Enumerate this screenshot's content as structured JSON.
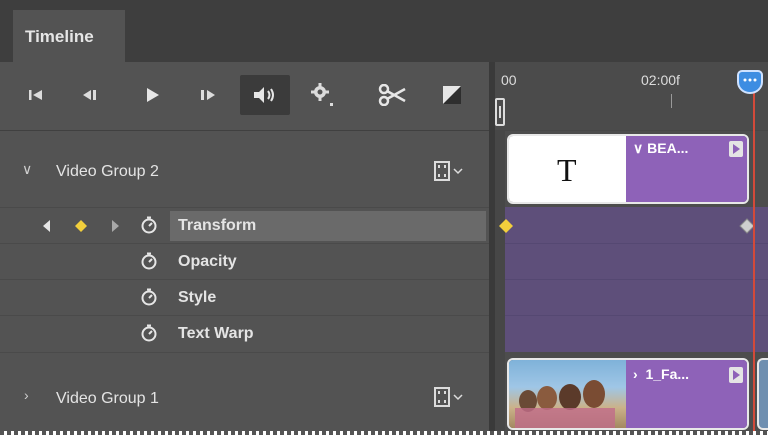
{
  "panel": {
    "tab_label": "Timeline"
  },
  "controls": [
    {
      "name": "go-to-first-frame-button",
      "icon": "skip-to-start-icon"
    },
    {
      "name": "previous-frame-button",
      "icon": "step-back-icon"
    },
    {
      "name": "play-button",
      "icon": "play-icon"
    },
    {
      "name": "next-frame-button",
      "icon": "step-forward-icon"
    },
    {
      "name": "mute-audio-button",
      "icon": "speaker-icon"
    },
    {
      "name": "settings-button",
      "icon": "gear-icon"
    },
    {
      "name": "split-at-playhead-button",
      "icon": "scissors-icon"
    },
    {
      "name": "transition-button",
      "icon": "transition-icon"
    }
  ],
  "ruler": {
    "start_label": "00",
    "mark_label": "02:00f"
  },
  "layers": {
    "group2": {
      "label": "Video Group 2",
      "expanded": true
    },
    "properties": [
      {
        "label": "Transform",
        "keyframed": true,
        "selected": true
      },
      {
        "label": "Opacity",
        "keyframed": false
      },
      {
        "label": "Style",
        "keyframed": false
      },
      {
        "label": "Text Warp",
        "keyframed": false
      }
    ],
    "group1": {
      "label": "Video Group 1",
      "expanded": false
    }
  },
  "clips": {
    "text_clip": {
      "glyph": "T",
      "title": "BEA..."
    },
    "video_clip": {
      "title": "1_Fa..."
    }
  },
  "colors": {
    "panel": "#535353",
    "track": "#5e4f7a",
    "clip": "#8e62b8",
    "keyframe": "#f2cf3c",
    "playhead": "#d24a3a",
    "playhead_knob": "#3d8de2"
  }
}
